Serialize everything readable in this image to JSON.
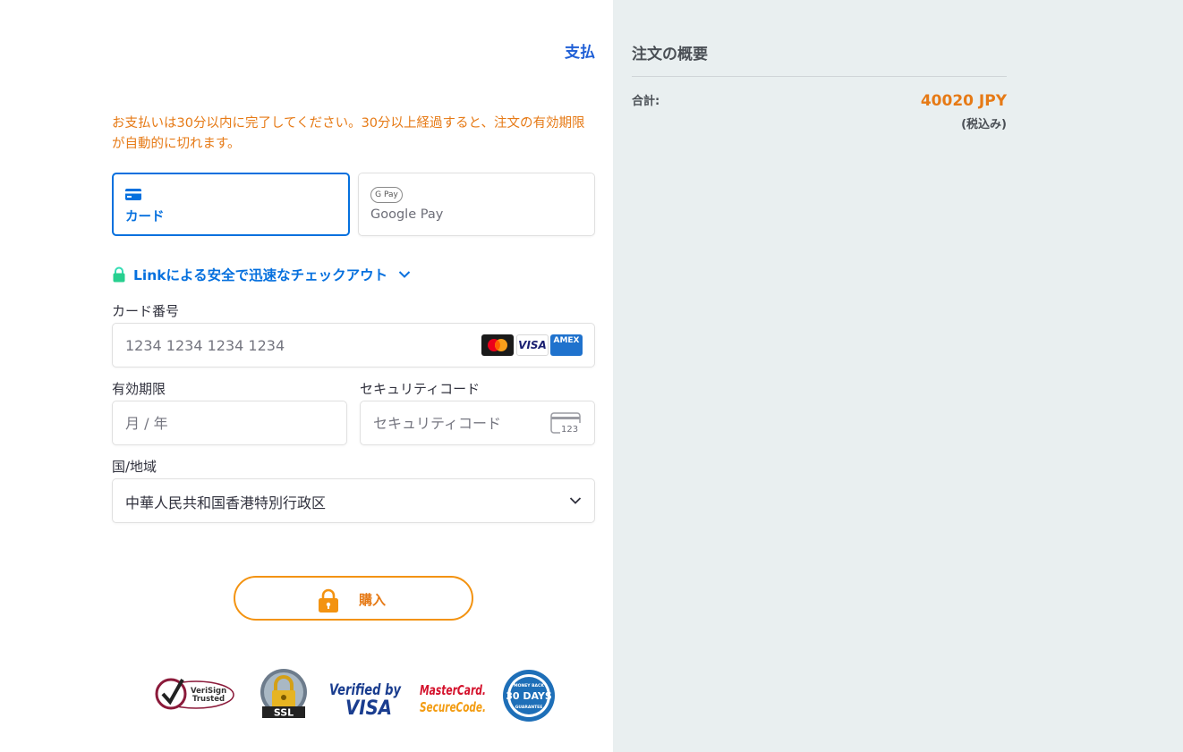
{
  "header": {
    "pay_title": "支払"
  },
  "notice": "お支払いは30分以内に完了してください。30分以上経過すると、注文の有効期限が自動的に切れます。",
  "payment_tabs": [
    {
      "label": "カード",
      "icon": "card-icon",
      "selected": true
    },
    {
      "label": "Google Pay",
      "badge": "G Pay",
      "icon": "google-pay-icon",
      "selected": false
    }
  ],
  "link": {
    "text": "Linkによる安全で迅速なチェックアウト",
    "icon": "lock-icon"
  },
  "form": {
    "card_number": {
      "label": "カード番号",
      "placeholder": "1234 1234 1234 1234",
      "brands": [
        "mastercard",
        "visa",
        "amex"
      ],
      "amex_text": "AMEX",
      "visa_text": "VISA"
    },
    "expiry": {
      "label": "有効期限",
      "placeholder": "月 / 年"
    },
    "cvc": {
      "label": "セキュリティコード",
      "placeholder": "セキュリティコード",
      "icon_text": "123"
    },
    "country": {
      "label": "国/地域",
      "value": "中華人民共和国香港特別行政区"
    }
  },
  "buy_button": {
    "label": "購入"
  },
  "trust_badges": {
    "verisign": {
      "line1": "VeriSign",
      "line2": "Trusted"
    },
    "ssl": "SSL",
    "verified_visa": {
      "line1": "Verified by",
      "line2": "VISA"
    },
    "mastercard": {
      "line1": "MasterCard.",
      "line2": "SecureCode."
    },
    "money_back": {
      "main": "30 DAYS",
      "top": "MONEY BACK",
      "bottom": "GUARANTEE"
    }
  },
  "summary": {
    "title": "注文の概要",
    "total_label": "合計:",
    "total_value": "40020 JPY",
    "tax_note": "(税込み)"
  },
  "colors": {
    "accent_orange": "#e67a16",
    "link_blue": "#0570de",
    "title_blue": "#1f5fd6",
    "panel_bg": "#e9eff0"
  }
}
